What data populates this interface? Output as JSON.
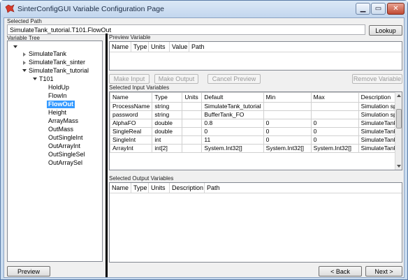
{
  "window": {
    "title": "SinterConfigGUI Variable Configuration Page"
  },
  "path": {
    "label": "Selected Path",
    "value": "SimulateTank_tutorial.T101.FlowOut",
    "lookup_label": "Lookup"
  },
  "tree": {
    "label": "Variable Tree",
    "nodes": [
      {
        "label": "SimulateTank"
      },
      {
        "label": "SimulateTank_sinter"
      },
      {
        "label": "SimulateTank_tutorial"
      },
      {
        "label": "T101"
      },
      {
        "label": "HoldUp"
      },
      {
        "label": "FlowIn"
      },
      {
        "label": "FlowOut"
      },
      {
        "label": "Height"
      },
      {
        "label": "ArrayMass"
      },
      {
        "label": "OutMass"
      },
      {
        "label": "OutSingleInt"
      },
      {
        "label": "OutArrayInt"
      },
      {
        "label": "OutSingleSel"
      },
      {
        "label": "OutArraySel"
      }
    ]
  },
  "preview": {
    "label": "Preview Variable",
    "columns": [
      "Name",
      "Type",
      "Units",
      "Value",
      "Path"
    ]
  },
  "actions": {
    "make_input": "Make Input",
    "make_output": "Make Output",
    "cancel_preview": "Cancel Preview",
    "remove_variable": "Remove Variable"
  },
  "inputs": {
    "label": "Selected Input Variables",
    "columns": [
      "Name",
      "Type",
      "Units",
      "Default",
      "Min",
      "Max",
      "Description"
    ],
    "rows": [
      [
        "ProcessName",
        "string",
        "",
        "SimulateTank_tutorial",
        "",
        "",
        "Simulation sp"
      ],
      [
        "password",
        "string",
        "",
        "BufferTank_FO",
        "",
        "",
        "Simulation sp"
      ],
      [
        "AlphaFO",
        "double",
        "",
        "0.8",
        "0",
        "0",
        "SimulateTank"
      ],
      [
        "SingleReal",
        "double",
        "",
        "0",
        "0",
        "0",
        "SimulateTank"
      ],
      [
        "SingleInt",
        "int",
        "",
        "11",
        "0",
        "0",
        "SimulateTank"
      ],
      [
        "ArrayInt",
        "int[2]",
        "",
        "System.Int32[]",
        "System.Int32[]",
        "System.Int32[]",
        "SimulateTank"
      ]
    ]
  },
  "outputs": {
    "label": "Selected Output Variables",
    "columns": [
      "Name",
      "Type",
      "Units",
      "Description",
      "Path"
    ]
  },
  "footer": {
    "preview_label": "Preview",
    "back_label": "< Back",
    "next_label": "Next >"
  },
  "colors": {
    "selection": "#3399ff",
    "splitter": "#000000"
  }
}
